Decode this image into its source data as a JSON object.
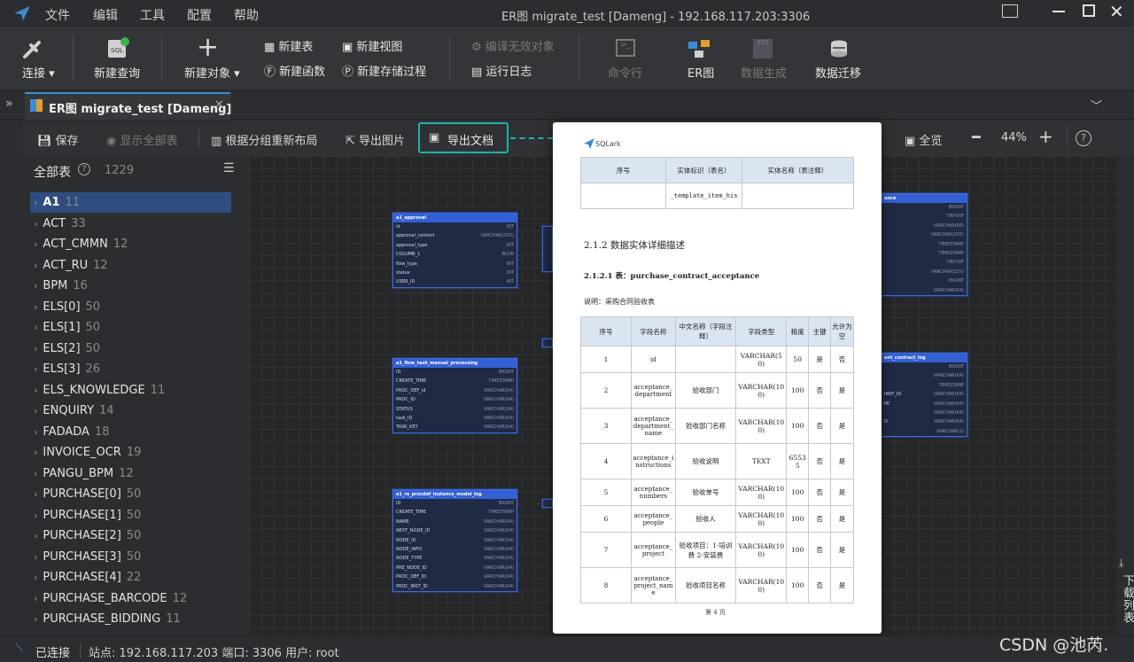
{
  "window": {
    "title": "ER图 migrate_test [Dameng]  - 192.168.117.203:3306"
  },
  "menu": [
    "文件",
    "编辑",
    "工具",
    "配置",
    "帮助"
  ],
  "toolbar": {
    "connect": "连接",
    "new_query": "新建查询",
    "new_object": "新建对象",
    "new_table": "新建表",
    "new_view": "新建视图",
    "new_function": "新建函数",
    "new_procedure": "新建存储过程",
    "compile_invalid": "编译无效对象",
    "run_log": "运行日志",
    "cmd": "命令行",
    "er": "ER图",
    "data_gen": "数据生成",
    "data_migrate": "数据迁移"
  },
  "tab": {
    "label": "ER图 migrate_test [Dameng]"
  },
  "subtoolbar": {
    "save": "保存",
    "show_all": "显示全部表",
    "relayout": "根据分组重新布局",
    "export_image": "导出图片",
    "export_doc": "导出文档",
    "overview": "全览",
    "zoom": "44%"
  },
  "sidebar": {
    "title": "全部表",
    "total": "1229",
    "items": [
      {
        "name": "A1",
        "count": "11"
      },
      {
        "name": "ACT",
        "count": "33"
      },
      {
        "name": "ACT_CMMN",
        "count": "12"
      },
      {
        "name": "ACT_RU",
        "count": "12"
      },
      {
        "name": "BPM",
        "count": "16"
      },
      {
        "name": "ELS[0]",
        "count": "50"
      },
      {
        "name": "ELS[1]",
        "count": "50"
      },
      {
        "name": "ELS[2]",
        "count": "50"
      },
      {
        "name": "ELS[3]",
        "count": "26"
      },
      {
        "name": "ELS_KNOWLEDGE",
        "count": "11"
      },
      {
        "name": "ENQUIRY",
        "count": "14"
      },
      {
        "name": "FADADA",
        "count": "18"
      },
      {
        "name": "INVOICE_OCR",
        "count": "19"
      },
      {
        "name": "PANGU_BPM",
        "count": "12"
      },
      {
        "name": "PURCHASE[0]",
        "count": "50"
      },
      {
        "name": "PURCHASE[1]",
        "count": "50"
      },
      {
        "name": "PURCHASE[2]",
        "count": "50"
      },
      {
        "name": "PURCHASE[3]",
        "count": "50"
      },
      {
        "name": "PURCHASE[4]",
        "count": "22"
      },
      {
        "name": "PURCHASE_BARCODE",
        "count": "12"
      },
      {
        "name": "PURCHASE_BIDDING",
        "count": "11"
      }
    ]
  },
  "er_tables": [
    {
      "name": "a1_approval",
      "rows": [
        [
          "id",
          "INT"
        ],
        [
          "approval_content",
          "VARCHAR(255)"
        ],
        [
          "approval_type",
          "INT"
        ],
        [
          "COLUMN_1",
          "BLOB"
        ],
        [
          "flow_type",
          "INT"
        ],
        [
          "status",
          "INT"
        ],
        [
          "USER_ID",
          "INT"
        ]
      ]
    },
    {
      "name": "a1_flow_task_manual_processing",
      "rows": [
        [
          "ID",
          "BIGINT"
        ],
        [
          "CREATE_TIME",
          "TIMESTAMP"
        ],
        [
          "PROC_DEF_id",
          "VARCHAR(64)"
        ],
        [
          "PROC_ID",
          "VARCHAR(64)"
        ],
        [
          "STATUS",
          "VARCHAR(64)"
        ],
        [
          "task_ID",
          "VARCHAR(64)"
        ],
        [
          "TASK_KEY",
          "VARCHAR(64)"
        ]
      ]
    },
    {
      "name": "a1_re_procdef_instance_model_log",
      "rows": [
        [
          "ID",
          "BIGINT"
        ],
        [
          "CREATE_TIME",
          "TIMESTAMP"
        ],
        [
          "NAME",
          "VARCHAR(64)"
        ],
        [
          "NEXT_NODE_ID",
          "VARCHAR(64)"
        ],
        [
          "NODE_ID",
          "VARCHAR(64)"
        ],
        [
          "NODE_INFO",
          "VARCHAR(64)"
        ],
        [
          "NODE_TYPE",
          "VARCHAR(64)"
        ],
        [
          "PRE_NODE_ID",
          "VARCHAR(64)"
        ],
        [
          "PROC_DEF_ID",
          "VARCHAR(64)"
        ],
        [
          "PROC_INST_ID",
          "VARCHAR(64)"
        ]
      ]
    },
    {
      "name": "ance",
      "rows": [
        [
          "",
          "BIGINT"
        ],
        [
          "",
          "TINYINT"
        ],
        [
          "",
          "VARCHAR(64)"
        ],
        [
          "",
          "VARCHAR(255)"
        ],
        [
          "",
          "TIMESTAMP"
        ],
        [
          "",
          "TIMESTAMP"
        ],
        [
          "",
          "TINYINT"
        ],
        [
          "",
          "VARCHAR(255)"
        ],
        [
          "",
          "BIGINT"
        ],
        [
          "",
          "VARCHAR(64)"
        ]
      ]
    },
    {
      "name": "ont_contract_log",
      "rows": [
        [
          "",
          "BIGINT"
        ],
        [
          "",
          "VARCHAR(64)"
        ],
        [
          "",
          "TIMESTAMP"
        ],
        [
          "INST_ID",
          "VARCHAR(64)"
        ],
        [
          "PE",
          "VARCHAR(64)"
        ],
        [
          "",
          "VARCHAR(64)"
        ],
        [
          "D",
          "VARCHAR(64)"
        ],
        [
          "",
          "VARCHAR(2)"
        ]
      ]
    }
  ],
  "doc": {
    "logo": "SQLark",
    "top_headers": [
      "序号",
      "实体标识（表名）",
      "实体名称（表注释）"
    ],
    "top_row": [
      "",
      "_template_item_his",
      ""
    ],
    "h2": "2.1.2 数据实体详细描述",
    "h3": "2.1.2.1 表：purchase_contract_acceptance",
    "desc": "说明：采购合同验收表",
    "headers": [
      "序号",
      "字段名称",
      "中文名称（字段注释）",
      "字段类型",
      "精度",
      "主键",
      "允许为空"
    ],
    "rows": [
      [
        "1",
        "id",
        "",
        "VARCHAR(50)",
        "50",
        "是",
        "否"
      ],
      [
        "2",
        "acceptance_department",
        "验收部门",
        "VARCHAR(100)",
        "100",
        "否",
        "是"
      ],
      [
        "3",
        "acceptance_department_name",
        "验收部门名称",
        "VARCHAR(100)",
        "100",
        "否",
        "是"
      ],
      [
        "4",
        "acceptance_instructions",
        "验收说明",
        "TEXT",
        "65535",
        "否",
        "是"
      ],
      [
        "5",
        "acceptance_numbers",
        "验收单号",
        "VARCHAR(100)",
        "100",
        "否",
        "是"
      ],
      [
        "6",
        "acceptance_people",
        "验收人",
        "VARCHAR(100)",
        "100",
        "否",
        "是"
      ],
      [
        "7",
        "acceptance_project",
        "验收项目：1-培训费 2-安装费",
        "VARCHAR(100)",
        "100",
        "否",
        "是"
      ],
      [
        "8",
        "acceptance_project_name",
        "验收项目名称",
        "VARCHAR(100)",
        "100",
        "否",
        "是"
      ]
    ],
    "page": "第 4 页"
  },
  "right_panel": {
    "label": "下载列表"
  },
  "status": {
    "connected": "已连接",
    "site_label": "站点:",
    "site": "192.168.117.203",
    "port_label": "端口:",
    "port": "3306",
    "user_label": "用户:",
    "user": "root"
  },
  "watermark": "CSDN @池芮."
}
